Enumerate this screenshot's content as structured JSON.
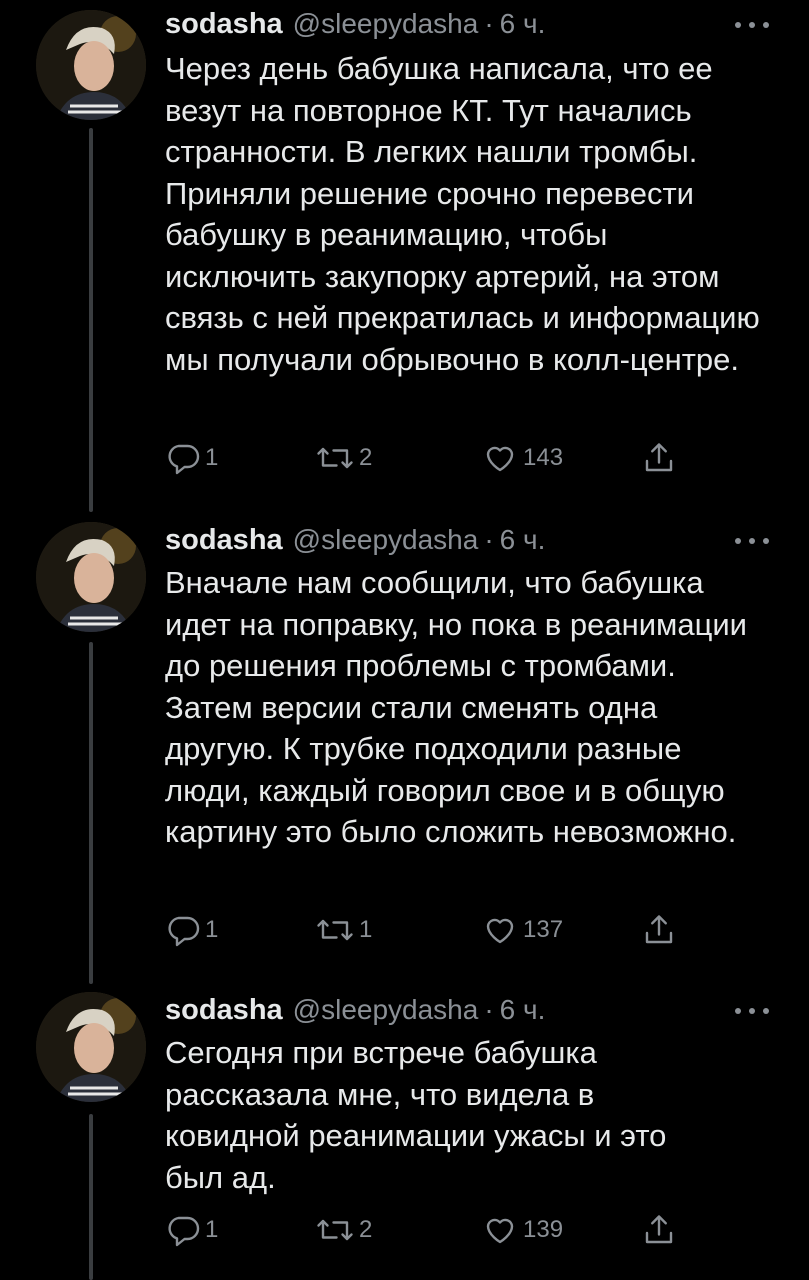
{
  "tweets": [
    {
      "name": "sodasha",
      "handle": "@sleepydasha",
      "dot": "·",
      "time": "6 ч.",
      "text": "Через день бабушка написала, что ее везут на повторное КТ. Тут начались странности. В легких нашли тромбы. Приняли решение срочно перевести бабушку в реанимацию, чтобы исключить закупорку артерий, на этом связь с ней прекратилась и информацию мы получали обрывочно в колл-центре.",
      "replies": "1",
      "retweets": "2",
      "likes": "143"
    },
    {
      "name": "sodasha",
      "handle": "@sleepydasha",
      "dot": "·",
      "time": "6 ч.",
      "text": "Вначале нам сообщили, что бабушка идет на поправку, но пока в реанимации до решения проблемы с тромбами. Затем версии стали сменять одна другую. К трубке подходили разные люди, каждый говорил свое и в общую картину это было сложить невозможно.",
      "replies": "1",
      "retweets": "1",
      "likes": "137"
    },
    {
      "name": "sodasha",
      "handle": "@sleepydasha",
      "dot": "·",
      "time": "6 ч.",
      "text": "Сегодня при встрече бабушка рассказала мне, что видела в ковидной реанимации ужасы и это был ад.",
      "replies": "1",
      "retweets": "2",
      "likes": "139"
    }
  ],
  "icons": {
    "reply": "reply-icon",
    "retweet": "retweet-icon",
    "like": "heart-icon",
    "share": "share-icon",
    "more": "more-icon"
  },
  "colors": {
    "background": "#000000",
    "text": "#e7e9ea",
    "secondary": "#8b9096",
    "thread_line": "#3a3d40"
  }
}
